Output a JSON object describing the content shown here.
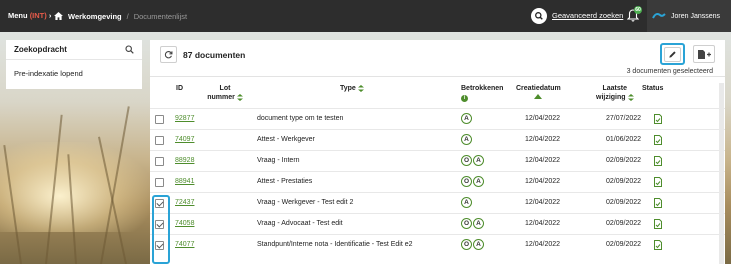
{
  "topbar": {
    "menu_label": "Menu",
    "env_label": "(INT)",
    "breadcrumbs": [
      "Werkomgeving",
      "Documentenlijst"
    ],
    "advanced_search": "Geavanceerd zoeken",
    "notification_count": "60",
    "user_name": "Joren Janssens"
  },
  "search_panel": {
    "title": "Zoekopdracht",
    "status": "Pre-indexatie lopend"
  },
  "main": {
    "doc_count": "87 documenten",
    "selected_count": "3 documenten geselecteerd",
    "columns": {
      "id": "ID",
      "lot": [
        "Lot",
        "nummer"
      ],
      "type": "Type",
      "parties": "Betrokkenen",
      "created": "Creatiedatum",
      "modified": [
        "Laatste",
        "wijziging"
      ],
      "status": "Status"
    },
    "rows": [
      {
        "id": "92877",
        "type": "document type om te testen",
        "parties": [
          "A"
        ],
        "created": "12/04/2022",
        "modified": "27/07/2022",
        "checked": false
      },
      {
        "id": "74097",
        "type": "Attest - Werkgever",
        "parties": [
          "A"
        ],
        "created": "12/04/2022",
        "modified": "01/06/2022",
        "checked": false
      },
      {
        "id": "88928",
        "type": "Vraag - Intern",
        "parties": [
          "O",
          "A"
        ],
        "created": "12/04/2022",
        "modified": "02/09/2022",
        "checked": false
      },
      {
        "id": "88941",
        "type": "Attest - Prestaties",
        "parties": [
          "O",
          "A"
        ],
        "created": "12/04/2022",
        "modified": "02/09/2022",
        "checked": false
      },
      {
        "id": "72437",
        "type": "Vraag - Werkgever - Test edit 2",
        "parties": [
          "A"
        ],
        "created": "12/04/2022",
        "modified": "02/09/2022",
        "checked": true
      },
      {
        "id": "74058",
        "type": "Vraag - Advocaat - Test edit",
        "parties": [
          "O",
          "A"
        ],
        "created": "12/04/2022",
        "modified": "02/09/2022",
        "checked": true
      },
      {
        "id": "74077",
        "type": "Standpunt/Interne nota - Identificatie - Test Edit e2",
        "parties": [
          "O",
          "A"
        ],
        "created": "12/04/2022",
        "modified": "02/09/2022",
        "checked": true
      }
    ]
  },
  "colors": {
    "topbar": "#2d2d2d",
    "accent_green": "#4e8d2c",
    "highlight_blue": "#2aa3d6",
    "env_red": "#e85b4a"
  }
}
